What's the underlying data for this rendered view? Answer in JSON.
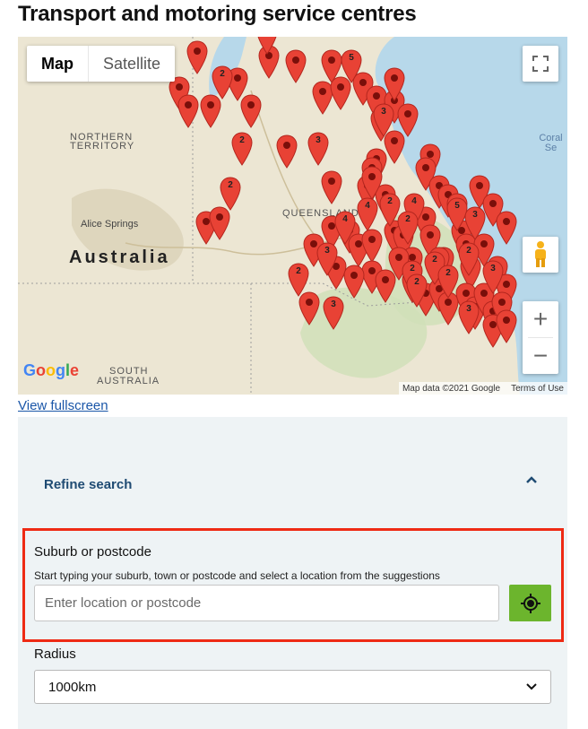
{
  "page": {
    "title": "Transport and motoring service centres",
    "view_fullscreen": "View fullscreen"
  },
  "map": {
    "type_buttons": {
      "map": "Map",
      "satellite": "Satellite"
    },
    "labels": {
      "northern_territory_1": "NORTHERN",
      "northern_territory_2": "TERRITORY",
      "queensland": "QUEENSLAND",
      "australia": "Australia",
      "alice_springs": "Alice Springs",
      "south_australia_1": "SOUTH",
      "south_australia_2": "AUSTRALIA",
      "coral_sea": "Coral Se"
    },
    "google_logo": "Google",
    "map_data": "Map data ©2021 Google",
    "terms": "Terms of Use",
    "zoom_in": "+",
    "zoom_out": "−",
    "marker_color": "#e84235",
    "marker_counts": [
      "2",
      "2",
      "5",
      "3",
      "2",
      "3",
      "2",
      "4",
      "2",
      "4",
      "2",
      "5",
      "3",
      "4",
      "3",
      "2",
      "3",
      "2",
      "2",
      "2",
      "2",
      "3",
      "3",
      "2"
    ]
  },
  "search": {
    "refine_label": "Refine search",
    "suburb_label": "Suburb or postcode",
    "suburb_hint": "Start typing your suburb, town or postcode and select a location from the suggestions",
    "suburb_placeholder": "Enter location or postcode",
    "suburb_value": "",
    "radius_label": "Radius",
    "radius_value": "1000km",
    "accent_color": "#6cb52d",
    "highlight_color": "#ee2a14"
  }
}
